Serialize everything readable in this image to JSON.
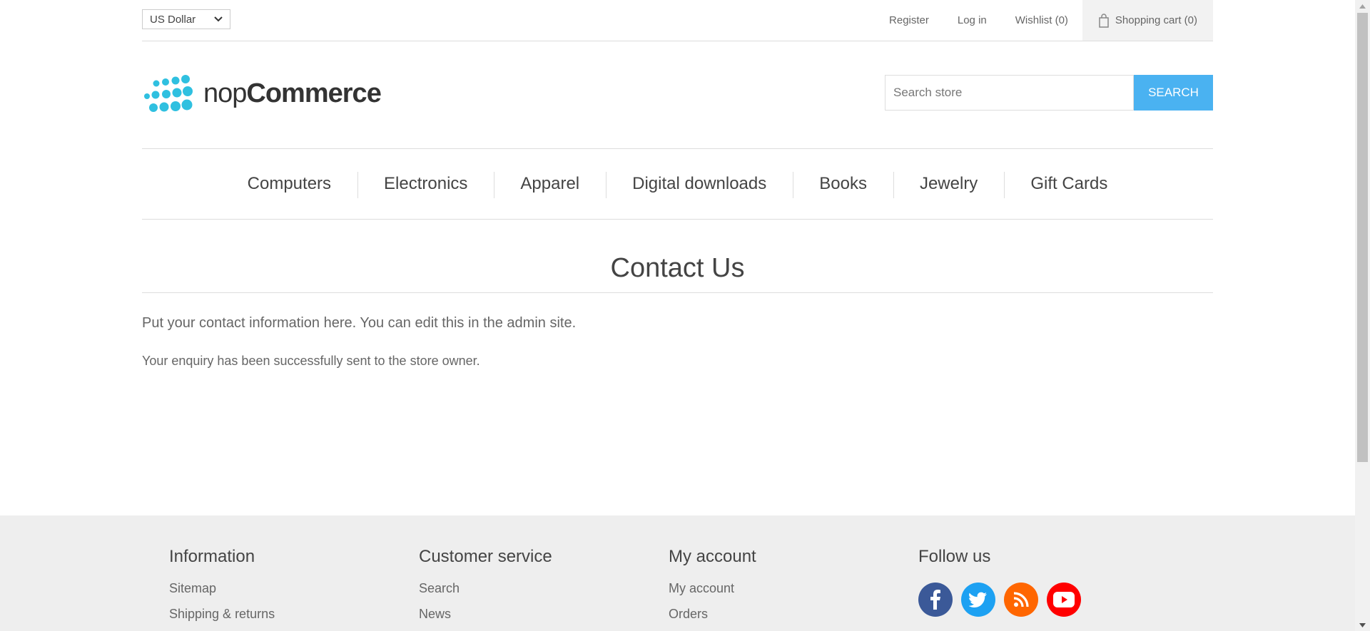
{
  "header": {
    "currency": {
      "selected": "US Dollar"
    },
    "links": {
      "register": "Register",
      "login": "Log in",
      "wishlist": "Wishlist (0)",
      "cart": "Shopping cart (0)"
    }
  },
  "logo": {
    "text_light": "nop",
    "text_bold": "Commerce"
  },
  "search": {
    "placeholder": "Search store",
    "button_label": "SEARCH"
  },
  "menu": {
    "items": [
      "Computers",
      "Electronics",
      "Apparel",
      "Digital downloads",
      "Books",
      "Jewelry",
      "Gift Cards"
    ]
  },
  "page": {
    "title": "Contact Us",
    "contact_info": "Put your contact information here. You can edit this in the admin site.",
    "result": "Your enquiry has been successfully sent to the store owner."
  },
  "footer": {
    "information": {
      "title": "Information",
      "items": [
        "Sitemap",
        "Shipping & returns"
      ]
    },
    "customer_service": {
      "title": "Customer service",
      "items": [
        "Search",
        "News"
      ]
    },
    "my_account": {
      "title": "My account",
      "items": [
        "My account",
        "Orders"
      ]
    },
    "follow_us": {
      "title": "Follow us",
      "colors": {
        "facebook": "#3b5998",
        "twitter": "#1da1f2",
        "rss": "#ff6600",
        "youtube": "#ff0000"
      }
    }
  }
}
